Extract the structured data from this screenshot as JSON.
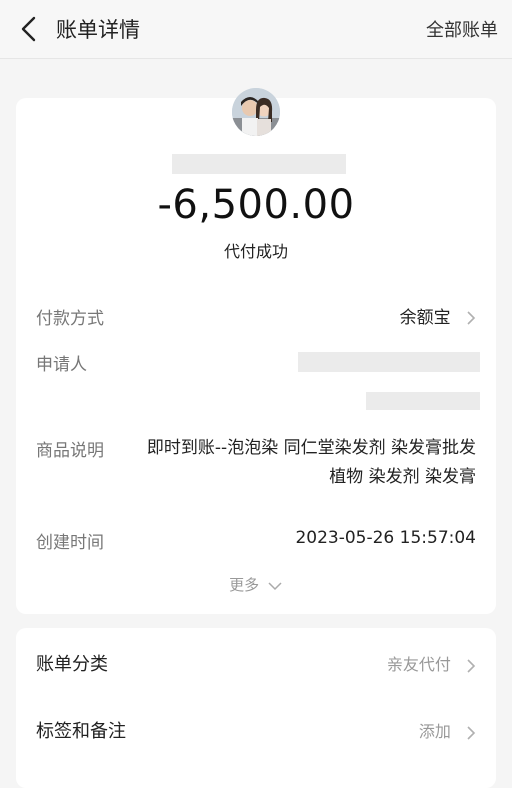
{
  "header": {
    "title": "账单详情",
    "right_link": "全部账单"
  },
  "summary": {
    "amount": "-6,500.00",
    "status": "代付成功"
  },
  "details": {
    "payment_method_label": "付款方式",
    "payment_method_value": "余额宝",
    "applicant_label": "申请人",
    "description_label": "商品说明",
    "description_value": "即时到账--泡泡染 同仁堂染发剂 染发膏批发植物 染发剂 染发膏",
    "created_time_label": "创建时间",
    "created_time_value": "2023-05-26 15:57:04",
    "more_label": "更多"
  },
  "extras": {
    "category_label": "账单分类",
    "category_value": "亲友代付",
    "tags_label": "标签和备注",
    "tags_value": "添加"
  },
  "icons": {
    "back": "chevron-left-icon",
    "chevron_right": "chevron-right-icon",
    "chevron_down": "chevron-down-icon"
  },
  "colors": {
    "background": "#f5f5f5",
    "card": "#ffffff",
    "muted_text": "#999999"
  }
}
